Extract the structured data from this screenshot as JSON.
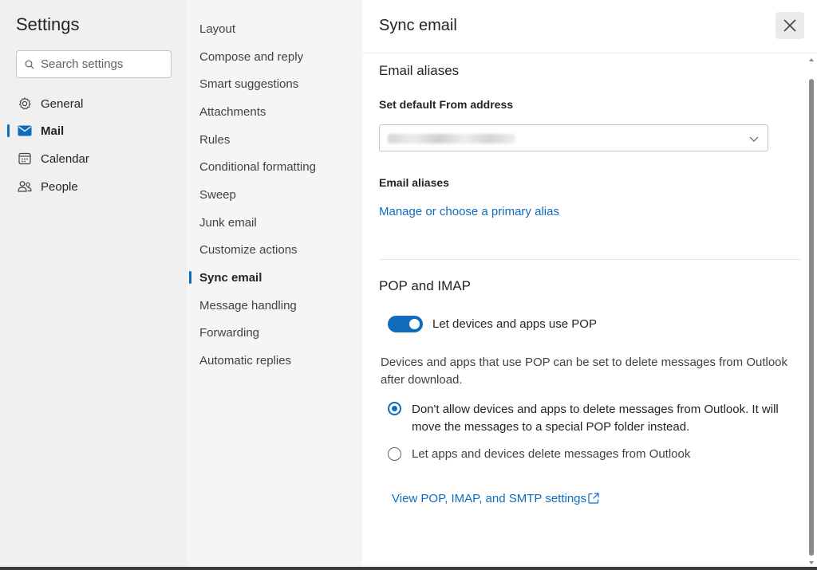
{
  "left": {
    "title": "Settings",
    "search_placeholder": "Search settings",
    "categories": [
      {
        "label": "General",
        "icon": "gear-icon"
      },
      {
        "label": "Mail",
        "icon": "mail-icon"
      },
      {
        "label": "Calendar",
        "icon": "calendar-icon"
      },
      {
        "label": "People",
        "icon": "people-icon"
      }
    ],
    "active_category": "Mail"
  },
  "subnav": {
    "items": [
      "Layout",
      "Compose and reply",
      "Smart suggestions",
      "Attachments",
      "Rules",
      "Conditional formatting",
      "Sweep",
      "Junk email",
      "Customize actions",
      "Sync email",
      "Message handling",
      "Forwarding",
      "Automatic replies"
    ],
    "active": "Sync email"
  },
  "main": {
    "title": "Sync email",
    "aliases": {
      "heading": "Email aliases",
      "from_label": "Set default From address",
      "aliases_label": "Email aliases",
      "manage_link": "Manage or choose a primary alias"
    },
    "pop": {
      "heading": "POP and IMAP",
      "toggle_label": "Let devices and apps use POP",
      "toggle_on": true,
      "description": "Devices and apps that use POP can be set to delete messages from Outlook after download.",
      "option1": "Don't allow devices and apps to delete messages from Outlook. It will move the messages to a special POP folder instead.",
      "option2": "Let apps and devices delete messages from Outlook",
      "selected_option": 1,
      "settings_link": "View POP, IMAP, and SMTP settings"
    }
  },
  "colors": {
    "accent": "#0f6cbd",
    "pane_left": "#f0f0f0",
    "pane_mid": "#f5f5f5"
  }
}
